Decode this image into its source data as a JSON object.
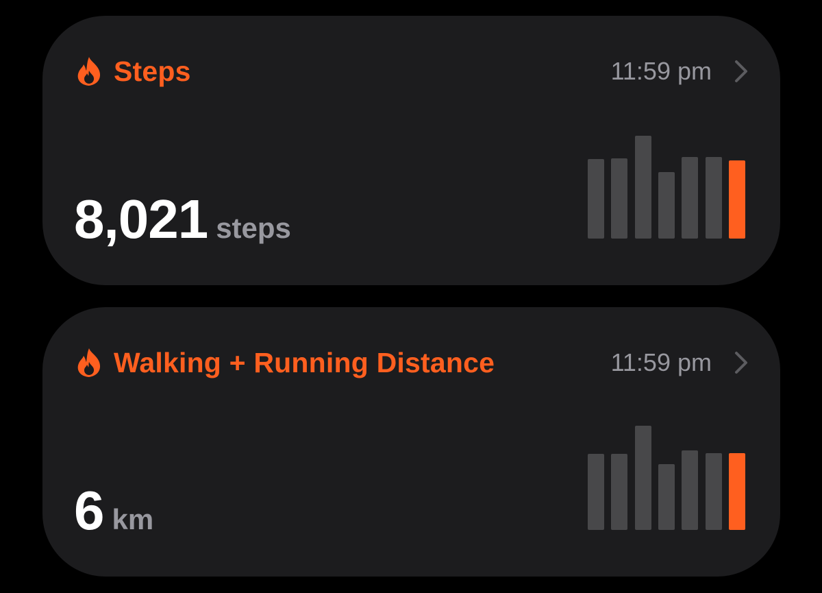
{
  "colors": {
    "accent": "#ff5f1f",
    "bar_inactive": "#48484a",
    "card_bg": "#1c1c1e",
    "secondary_text": "#98989f"
  },
  "cards": [
    {
      "icon": "flame-icon",
      "title": "Steps",
      "time": "11:59 pm",
      "value": "8,021",
      "unit": "steps",
      "chart_data": {
        "type": "bar",
        "values": [
          0.76,
          0.77,
          0.99,
          0.64,
          0.78,
          0.78,
          0.75
        ],
        "highlight_index": 6
      }
    },
    {
      "icon": "flame-icon",
      "title": "Walking + Running Distance",
      "time": "11:59 pm",
      "value": "6",
      "unit": "km",
      "chart_data": {
        "type": "bar",
        "values": [
          0.73,
          0.73,
          1.0,
          0.63,
          0.76,
          0.74,
          0.74
        ],
        "highlight_index": 6
      }
    }
  ]
}
